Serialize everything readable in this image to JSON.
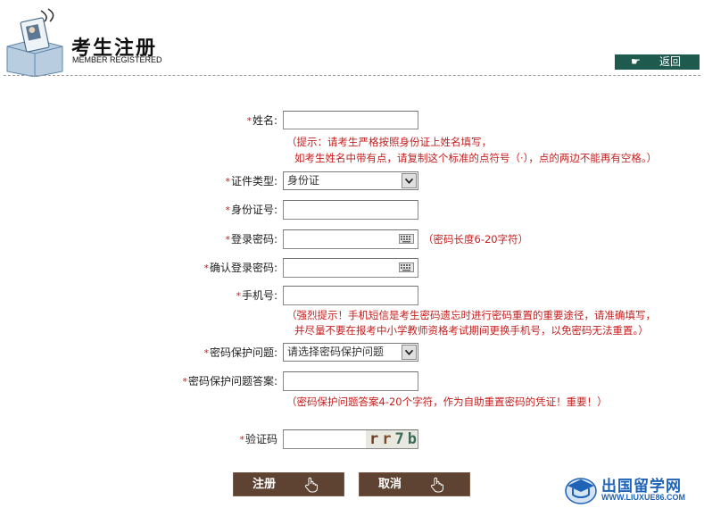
{
  "header": {
    "title": "考生注册",
    "subtitle": "MEMBER REGISTERED",
    "back_label": "返回"
  },
  "form": {
    "required_mark": "*",
    "name_label": "姓名:",
    "name_hint_line1": "（提示：请考生严格按照身份证上姓名填写，",
    "name_hint_line2": "如考生姓名中带有点，请复制这个标准的点符号（·），点的两边不能再有空格。）",
    "id_type_label": "证件类型:",
    "id_type_value": "身份证",
    "id_number_label": "身份证号:",
    "password_label": "登录密码:",
    "password_hint": "（密码长度6-20字符）",
    "confirm_password_label": "确认登录密码:",
    "phone_label": "手机号:",
    "phone_hint_line1": "（强烈提示！手机短信是考生密码遗忘时进行密码重置的重要途径，请准确填写，",
    "phone_hint_line2": "并尽量不要在报考中小学教师资格考试期间更换手机号，以免密码无法重置。）",
    "security_question_label": "密码保护问题:",
    "security_question_value": "请选择密码保护问题",
    "security_answer_label": "密码保护问题答案:",
    "security_answer_hint": "（密码保护问题答案4-20个字符，作为自助重置密码的凭证！重要！）",
    "captcha_label": "验证码",
    "captcha_text": "rr7b"
  },
  "buttons": {
    "register": "注册",
    "cancel": "取消"
  },
  "watermark": {
    "title": "出国留学网",
    "url": "WWW.LIUXUE86.COM"
  },
  "colors": {
    "required": "#d31818",
    "hint": "#c41e1e",
    "back_button": "#1f5a4f",
    "action_button": "#5e4332",
    "watermark": "#1f63b6"
  }
}
